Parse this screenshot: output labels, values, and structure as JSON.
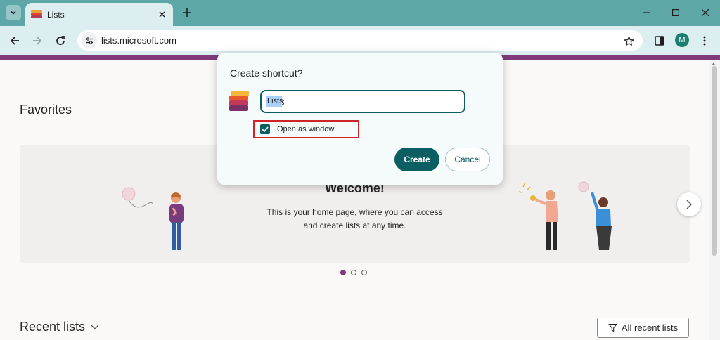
{
  "browser": {
    "tab_title": "Lists",
    "url": "lists.microsoft.com",
    "profile_initial": "M",
    "theme_color": "#5ea7a9",
    "toolbar_color": "#dceeef"
  },
  "icons": {
    "tab_search": "tab-search-icon",
    "new_tab": "plus-icon",
    "back": "arrow-left-icon",
    "forward": "arrow-right-icon",
    "reload": "reload-icon",
    "site_info": "tune-icon",
    "bookmark": "star-icon",
    "side_panel": "side-panel-icon",
    "menu": "kebab-menu-icon",
    "filter": "filter-icon",
    "chevron": "chevron-down-icon",
    "next": "chevron-right-icon"
  },
  "page": {
    "favorites_title": "Favorites",
    "welcome_title": "Welcome!",
    "welcome_line1": "This is your home page, where you can access",
    "welcome_line2": "and create lists at any time.",
    "carousel_page": 1,
    "carousel_pages": 3,
    "recent_title": "Recent lists",
    "all_recent_label": "All recent lists",
    "brand_color": "#80397b"
  },
  "dialog": {
    "title": "Create shortcut?",
    "name_value": "Lists",
    "checkbox_label": "Open as window",
    "checkbox_checked": true,
    "create_label": "Create",
    "cancel_label": "Cancel",
    "accent_color": "#0b5e61"
  }
}
